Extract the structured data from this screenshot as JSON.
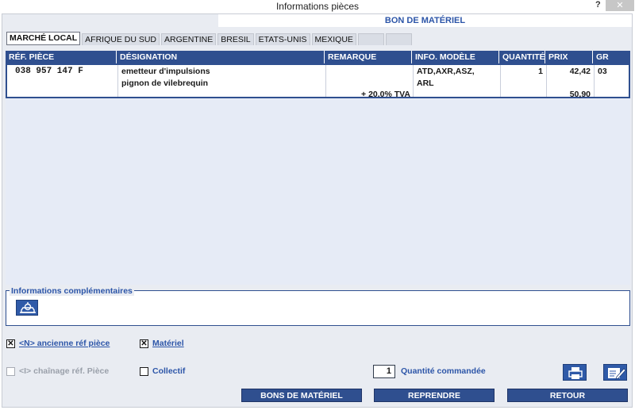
{
  "window": {
    "title": "Informations pièces",
    "help": "?",
    "close": "✕"
  },
  "banner": "BON DE MATÉRIEL",
  "tabs": [
    "MARCHÉ LOCAL",
    "AFRIQUE DU SUD",
    "ARGENTINE",
    "BRESIL",
    "ETATS-UNIS",
    "MEXIQUE",
    "",
    ""
  ],
  "table": {
    "headers": [
      "RÉF. PIÈCE",
      "DÉSIGNATION",
      "REMARQUE",
      "INFO. MODÈLE",
      "QUANTITÉ",
      "PRIX",
      "GR"
    ],
    "row": {
      "ref": "038 957 147 F",
      "designation_1": "emetteur d'impulsions",
      "designation_2": "pignon de vilebrequin",
      "remarque": "+ 20.0% TVA",
      "modele_1": "ATD,AXR,ASZ,",
      "modele_2": "ARL",
      "quantite": "1",
      "prix": "42,42",
      "prix_ttc": "50,90",
      "gr": "03"
    }
  },
  "info": {
    "legend": "Informations complémentaires"
  },
  "options": {
    "ancienne_ref": "<N> ancienne réf pièce",
    "ancienne_ref_checked": true,
    "materiel": "Matériel",
    "materiel_checked": true,
    "chainage": "<I> chaînage réf. Pièce",
    "chainage_checked": false,
    "collectif": "Collectif",
    "collectif_checked": false
  },
  "order": {
    "quantity": "1",
    "label": "Quantité commandée"
  },
  "buttons": {
    "bons": "BONS DE MATÉRIEL",
    "reprendre": "REPRENDRE",
    "retour": "RETOUR"
  },
  "colors": {
    "header_blue": "#2f4f8f",
    "label_blue": "#2c55a8",
    "panel_bg": "#e9ecf2"
  }
}
